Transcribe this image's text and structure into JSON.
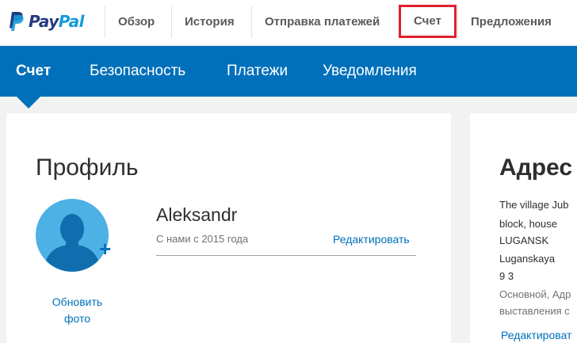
{
  "brand": {
    "logo_text_pay": "Pay",
    "logo_text_pal": "Pal",
    "logo_icon": "paypal-p-icon"
  },
  "topnav": {
    "items": [
      {
        "label": "Обзор"
      },
      {
        "label": "История"
      },
      {
        "label": "Отправка платежей"
      },
      {
        "label": "Счет",
        "highlighted": true
      },
      {
        "label": "Предложения"
      }
    ],
    "highlight_color": "#e0202c"
  },
  "subnav": {
    "items": [
      {
        "label": "Счет",
        "current": true
      },
      {
        "label": "Безопасность"
      },
      {
        "label": "Платежи"
      },
      {
        "label": "Уведомления"
      }
    ],
    "background": "#0070ba"
  },
  "profile": {
    "title": "Профиль",
    "name": "Aleksandr",
    "member_since": "С нами с 2015 года",
    "edit_label": "Редактировать",
    "update_photo_line1": "Обновить",
    "update_photo_line2": "фото",
    "avatar_icon": "user-silhouette-icon",
    "add_icon": "plus-icon"
  },
  "address": {
    "title": "Адрес",
    "lines": [
      "The village Jub",
      "block, house",
      "LUGANSK",
      "Luganskaya",
      "9       3",
      "Основной, Адр",
      "выставления с"
    ],
    "edit_label": "Редактироват"
  }
}
